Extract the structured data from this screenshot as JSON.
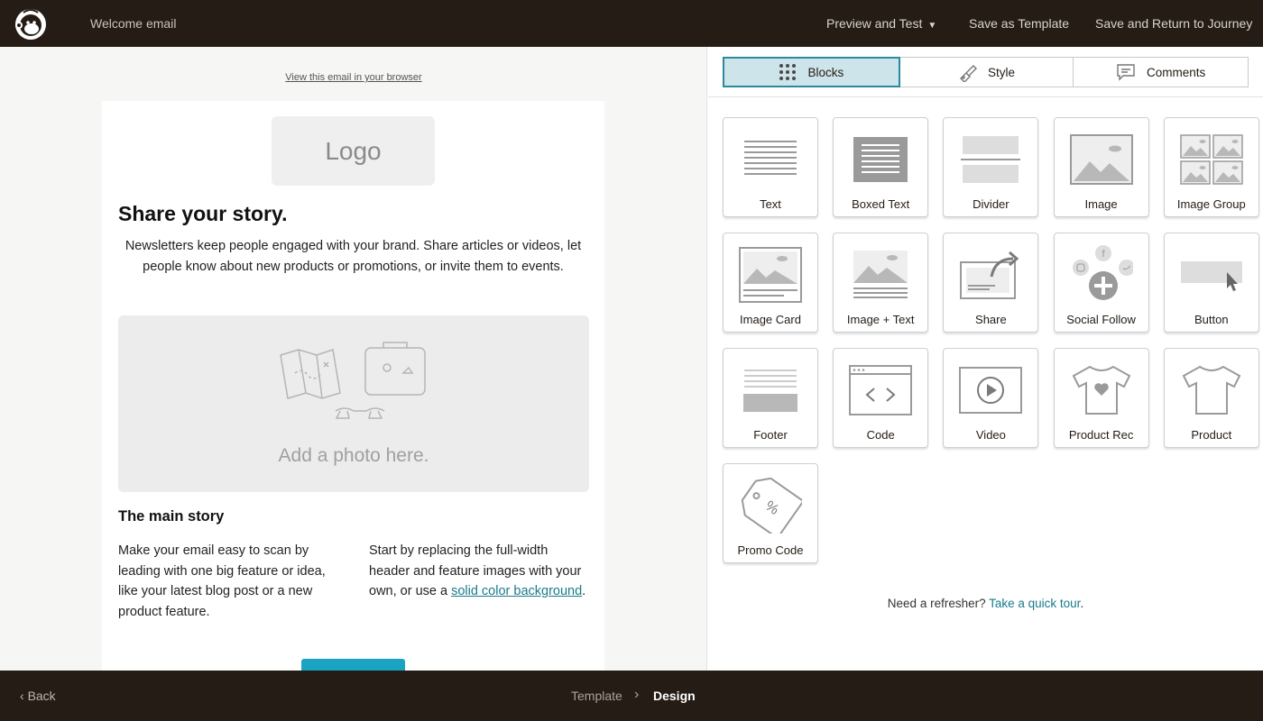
{
  "header": {
    "doc_title": "Welcome email",
    "preview_test": "Preview and Test",
    "save_template": "Save as Template",
    "save_return": "Save and Return to Journey"
  },
  "email": {
    "view_link": "View this email in your browser",
    "logo_placeholder": "Logo",
    "headline": "Share your story.",
    "intro": "Newsletters keep people engaged with your brand. Share articles or videos, let people know about new products or promotions, or invite them to events.",
    "photo_caption": "Add a photo here.",
    "main_story_title": "The main story",
    "col_left": "Make your email easy to scan by leading with one big feature or idea, like your latest blog post or a new product feature.",
    "col_right_text": "Start by replacing the full-width header and feature images with your own, or use a ",
    "col_right_link": "solid color background",
    "col_right_end": "."
  },
  "tabs": {
    "blocks": "Blocks",
    "style": "Style",
    "comments": "Comments"
  },
  "blocks": [
    {
      "label": "Text",
      "icon": "text-icon"
    },
    {
      "label": "Boxed Text",
      "icon": "boxed-text-icon"
    },
    {
      "label": "Divider",
      "icon": "divider-icon"
    },
    {
      "label": "Image",
      "icon": "image-icon"
    },
    {
      "label": "Image Group",
      "icon": "image-group-icon"
    },
    {
      "label": "Image Card",
      "icon": "image-card-icon"
    },
    {
      "label": "Image + Text",
      "icon": "image-text-icon"
    },
    {
      "label": "Share",
      "icon": "share-icon"
    },
    {
      "label": "Social Follow",
      "icon": "social-follow-icon"
    },
    {
      "label": "Button",
      "icon": "button-icon"
    },
    {
      "label": "Footer",
      "icon": "footer-icon"
    },
    {
      "label": "Code",
      "icon": "code-icon"
    },
    {
      "label": "Video",
      "icon": "video-icon"
    },
    {
      "label": "Product Rec",
      "icon": "product-rec-icon"
    },
    {
      "label": "Product",
      "icon": "product-icon"
    },
    {
      "label": "Promo Code",
      "icon": "promo-code-icon"
    }
  ],
  "refresher": {
    "text": "Need a refresher? ",
    "link": "Take a quick tour",
    "end": "."
  },
  "footer": {
    "back": "Back",
    "crumb_template": "Template",
    "crumb_design": "Design"
  },
  "colors": {
    "bar": "#241c15",
    "accent": "#2b8aa0",
    "active_tab": "#cde4ea",
    "cta": "#1aa3c3"
  }
}
